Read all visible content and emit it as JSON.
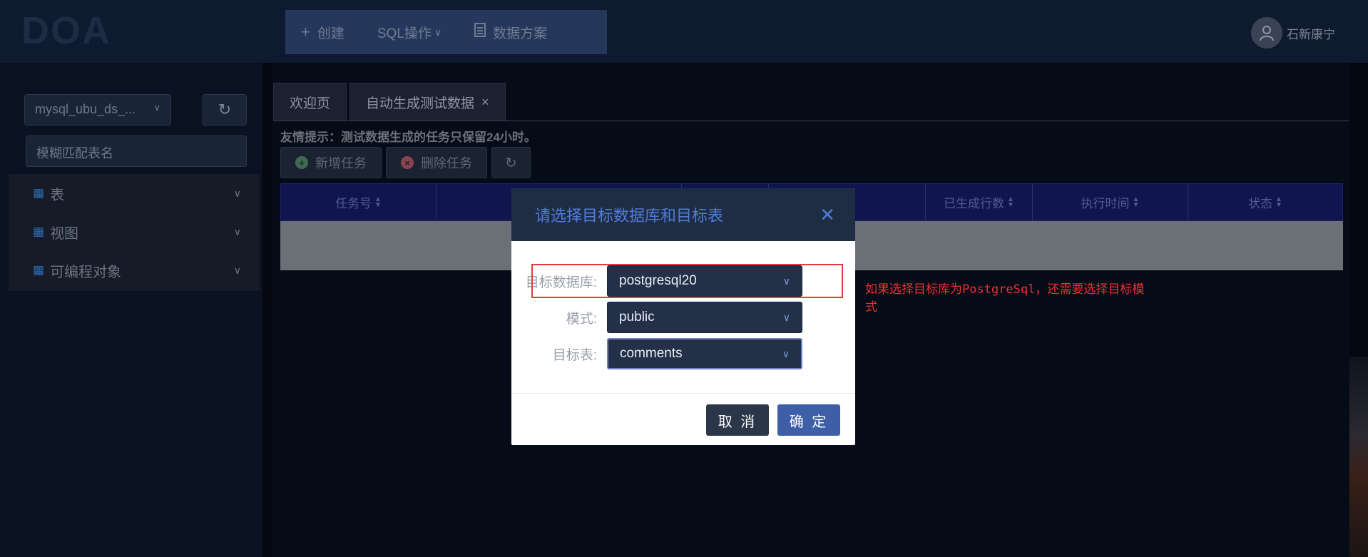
{
  "header": {
    "logo": "DOA",
    "menu": [
      {
        "icon": "plus-icon",
        "label": "创建"
      },
      {
        "label": "SQL操作",
        "icon": "chevron-down-icon"
      },
      {
        "icon": "document-icon",
        "label": "数据方案"
      }
    ],
    "user": {
      "name": "石新康宁",
      "icon": "user-icon"
    }
  },
  "sidebar": {
    "datasource": "mysql_ubu_ds_...",
    "search_placeholder": "模糊匹配表名",
    "tree": [
      {
        "label": "表",
        "icon": "calendar-icon"
      },
      {
        "label": "视图",
        "icon": "calendar-icon"
      },
      {
        "label": "可编程对象",
        "icon": "calendar-icon"
      }
    ]
  },
  "tabs": [
    {
      "label": "欢迎页"
    },
    {
      "label": "自动生成测试数据",
      "closable": true
    }
  ],
  "tip": "友情提示：测试数据生成的任务只保留24小时。",
  "actions": {
    "add": "新增任务",
    "delete": "删除任务"
  },
  "table": {
    "columns": [
      "任务号",
      "",
      "",
      "",
      "已生成行数",
      "执行时间",
      "状态"
    ]
  },
  "modal": {
    "title": "请选择目标数据库和目标表",
    "fields": [
      {
        "label": "目标数据库:",
        "value": "postgresql20"
      },
      {
        "label": "模式:",
        "value": "public"
      },
      {
        "label": "目标表:",
        "value": "comments"
      }
    ],
    "cancel": "取 消",
    "ok": "确 定"
  },
  "annotation": "如果选择目标库为PostgreSql，还需要选择目标模式",
  "colors": {
    "accent": "#4f7bd8",
    "annotation_red": "#ee3030",
    "primary_button": "#3e5fa8"
  }
}
